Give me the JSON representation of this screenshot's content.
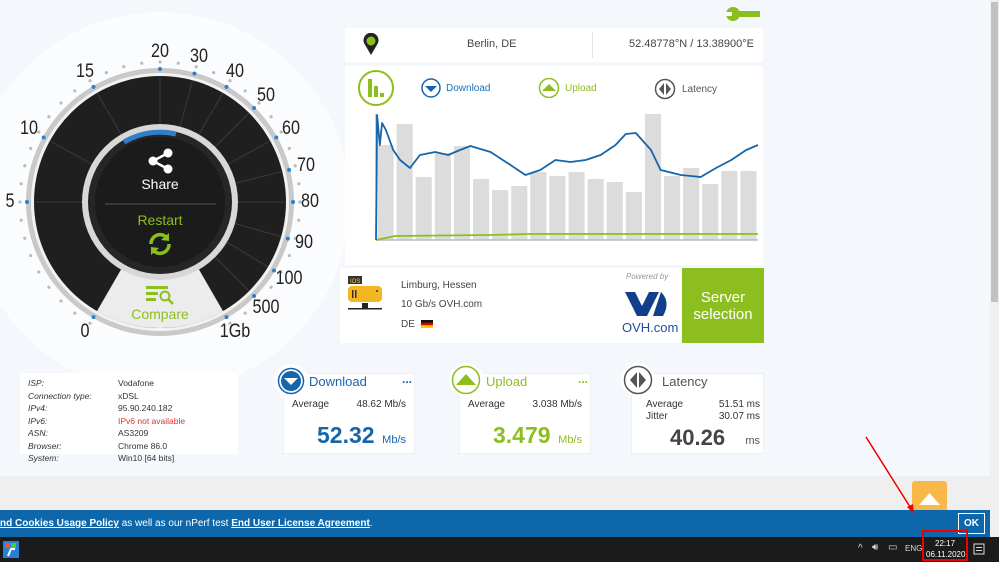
{
  "location": {
    "city": "Berlin, DE",
    "coords": "52.48778°N / 13.38900°E"
  },
  "gauge": {
    "labels": [
      "0",
      "5",
      "10",
      "15",
      "20",
      "30",
      "40",
      "50",
      "60",
      "70",
      "80",
      "90",
      "100",
      "500",
      "1Gb"
    ],
    "share": "Share",
    "restart": "Restart",
    "compare": "Compare",
    "progress_color": "#2f7fc9"
  },
  "chart": {
    "legend": {
      "download": "Download",
      "upload": "Upload",
      "latency": "Latency"
    },
    "chart_data": {
      "type": "bar+line",
      "note_units": "relative",
      "latency_bars": [
        95,
        116,
        63,
        87,
        94,
        61,
        50,
        54,
        68,
        64,
        68,
        61,
        58,
        48,
        126,
        64,
        72,
        56,
        69,
        69
      ],
      "download_line": [
        [
          0,
          0
        ],
        [
          0.3,
          125
        ],
        [
          1,
          95
        ],
        [
          1.6,
          117
        ],
        [
          2.6,
          110
        ],
        [
          4.5,
          90
        ],
        [
          6.3,
          80
        ],
        [
          8.9,
          72
        ],
        [
          11.5,
          85
        ],
        [
          15.5,
          88
        ],
        [
          18.9,
          85
        ],
        [
          22,
          90
        ],
        [
          24.7,
          94
        ],
        [
          30,
          88
        ],
        [
          35.2,
          75
        ],
        [
          39.1,
          65
        ],
        [
          43,
          70
        ],
        [
          47,
          80
        ],
        [
          50.9,
          78
        ],
        [
          54.9,
          80
        ],
        [
          58.8,
          85
        ],
        [
          62.7,
          95
        ],
        [
          65.4,
          106
        ],
        [
          68,
          107
        ],
        [
          72,
          90
        ],
        [
          74.5,
          70
        ],
        [
          79.8,
          65
        ],
        [
          85,
          63
        ],
        [
          89,
          72
        ],
        [
          93,
          80
        ],
        [
          96.9,
          90
        ],
        [
          100,
          95
        ]
      ],
      "upload_line": [
        [
          0,
          0
        ],
        [
          5,
          4
        ],
        [
          30,
          5
        ],
        [
          40,
          6
        ],
        [
          60,
          6
        ],
        [
          80,
          6
        ],
        [
          100,
          6
        ]
      ],
      "colors": {
        "download": "#1565ad",
        "upload": "#8cbf1e",
        "bars": "#dcdcdc"
      }
    }
  },
  "server": {
    "city": "Limburg, Hessen",
    "provider": "10 Gb/s OVH.com",
    "country": "DE",
    "powered_by": "Powered by",
    "brand": "OVH.com",
    "button": "Server selection"
  },
  "info": [
    [
      "ISP:",
      "Vodafone"
    ],
    [
      "Connection type:",
      "xDSL"
    ],
    [
      "IPv4:",
      "95.90.240.182"
    ],
    [
      "IPv6:",
      "IPv6 not available"
    ],
    [
      "ASN:",
      "AS3209"
    ],
    [
      "Browser:",
      "Chrome 86.0"
    ],
    [
      "System:",
      "Win10 [64 bits]"
    ]
  ],
  "download": {
    "title": "Download",
    "more": "...",
    "avg_label": "Average",
    "avg": "48.62 Mb/s",
    "value": "52.32",
    "unit": "Mb/s"
  },
  "upload": {
    "title": "Upload",
    "more": "...",
    "avg_label": "Average",
    "avg": "3.038 Mb/s",
    "value": "3.479",
    "unit": "Mb/s"
  },
  "latency": {
    "title": "Latency",
    "avg_label": "Average",
    "avg": "51.51 ms",
    "jitter_label": "Jitter",
    "jitter": "30.07 ms",
    "value": "40.26",
    "unit": "ms"
  },
  "cookie": {
    "link1": "nd Cookies Usage Policy",
    "middle": " as well as our nPerf test ",
    "link2": "End User License Agreement",
    "end": ".",
    "ok": "OK"
  },
  "taskbar": {
    "lang": "ENG",
    "time": "22:17",
    "date": "06.11.2020"
  }
}
